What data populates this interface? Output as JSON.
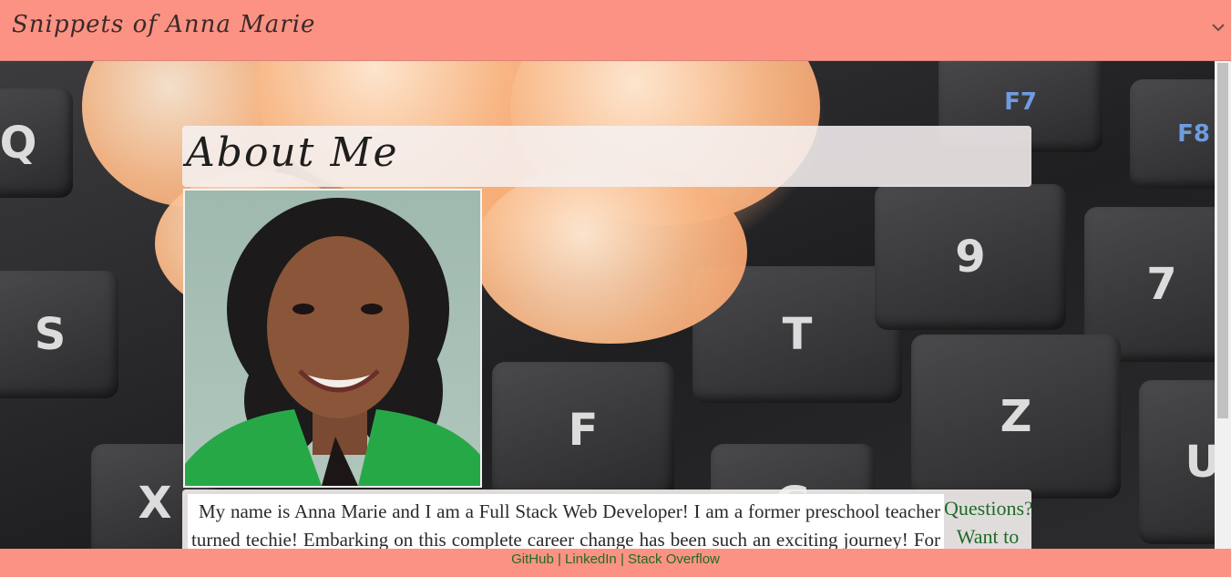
{
  "navbar": {
    "brand": "Snippets of Anna Marie",
    "toggle_icon": "chevron-down-icon"
  },
  "about": {
    "heading": "About Me",
    "bio": "My name is Anna Marie and I am a Full Stack Web Developer! I am a former preschool teacher turned techie! Embarking on this complete career change has been such an exciting journey! For me, the most",
    "cta": "Questions? Want to"
  },
  "footer": {
    "links": [
      "GitHub",
      "LinkedIn",
      "Stack Overflow"
    ],
    "separator": "|"
  },
  "colors": {
    "nav_bg": "#fc9283",
    "link_green": "#1e6b26"
  }
}
